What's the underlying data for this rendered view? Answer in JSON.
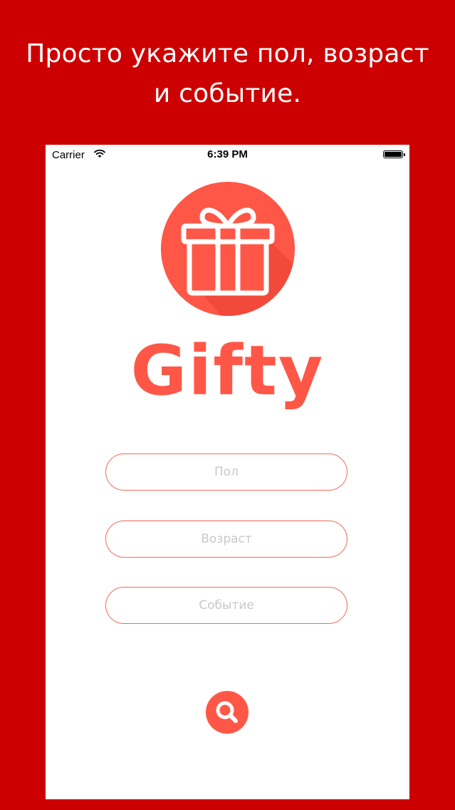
{
  "headline": {
    "line1": "Просто укажите пол, возраст",
    "line2": "и событие."
  },
  "status_bar": {
    "carrier": "Carrier",
    "time": "6:39 PM",
    "wifi_icon": "wifi-icon",
    "battery_icon": "battery-icon"
  },
  "app": {
    "logo_icon": "gift-box-icon",
    "brand_name": "Gifty",
    "brand_color": "#ff5747"
  },
  "form": {
    "gender_placeholder": "Пол",
    "age_placeholder": "Возраст",
    "event_placeholder": "Событие",
    "search_icon": "search-icon"
  },
  "colors": {
    "background": "#cc0000",
    "accent": "#ff5747",
    "field_border": "#f26b5b",
    "placeholder": "#c7c7cd"
  }
}
